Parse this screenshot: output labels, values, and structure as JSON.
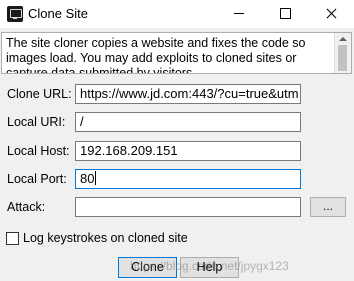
{
  "window": {
    "title": "Clone Site"
  },
  "description": {
    "text": "The site cloner copies a website and fixes the code so images load. You may add exploits to cloned sites or capture data submitted by visitors"
  },
  "form": {
    "clone_url": {
      "label": "Clone URL:",
      "value": "https://www.jd.com:443/?cu=true&utm"
    },
    "local_uri": {
      "label": "Local URI:",
      "value": "/"
    },
    "local_host": {
      "label": "Local Host:",
      "value": "192.168.209.151"
    },
    "local_port": {
      "label": "Local Port:",
      "value": "80"
    },
    "attack": {
      "label": "Attack:",
      "value": "",
      "browse_label": "..."
    },
    "log_keystrokes": {
      "label": "Log keystrokes on cloned site",
      "checked": false
    }
  },
  "buttons": {
    "clone": "Clone",
    "help": "Help"
  },
  "watermark": "https://blog.csdn.net/jpygx123"
}
